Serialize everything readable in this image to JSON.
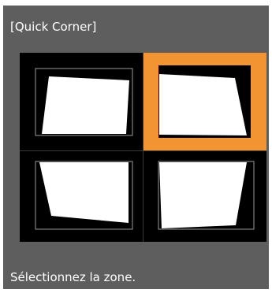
{
  "dialog": {
    "title": "[Quick Corner]",
    "instruction": "Sélectionnez la zone.",
    "selected_zone": "top-right"
  },
  "zones": [
    {
      "id": "top-left",
      "selected": false
    },
    {
      "id": "top-right",
      "selected": true
    },
    {
      "id": "bottom-left",
      "selected": false
    },
    {
      "id": "bottom-right",
      "selected": false
    }
  ],
  "colors": {
    "panel_bg": "#5e5e5e",
    "grid_bg": "#000000",
    "selection": "#f39433",
    "shape": "#ffffff",
    "guide": "#9a9a9a"
  }
}
